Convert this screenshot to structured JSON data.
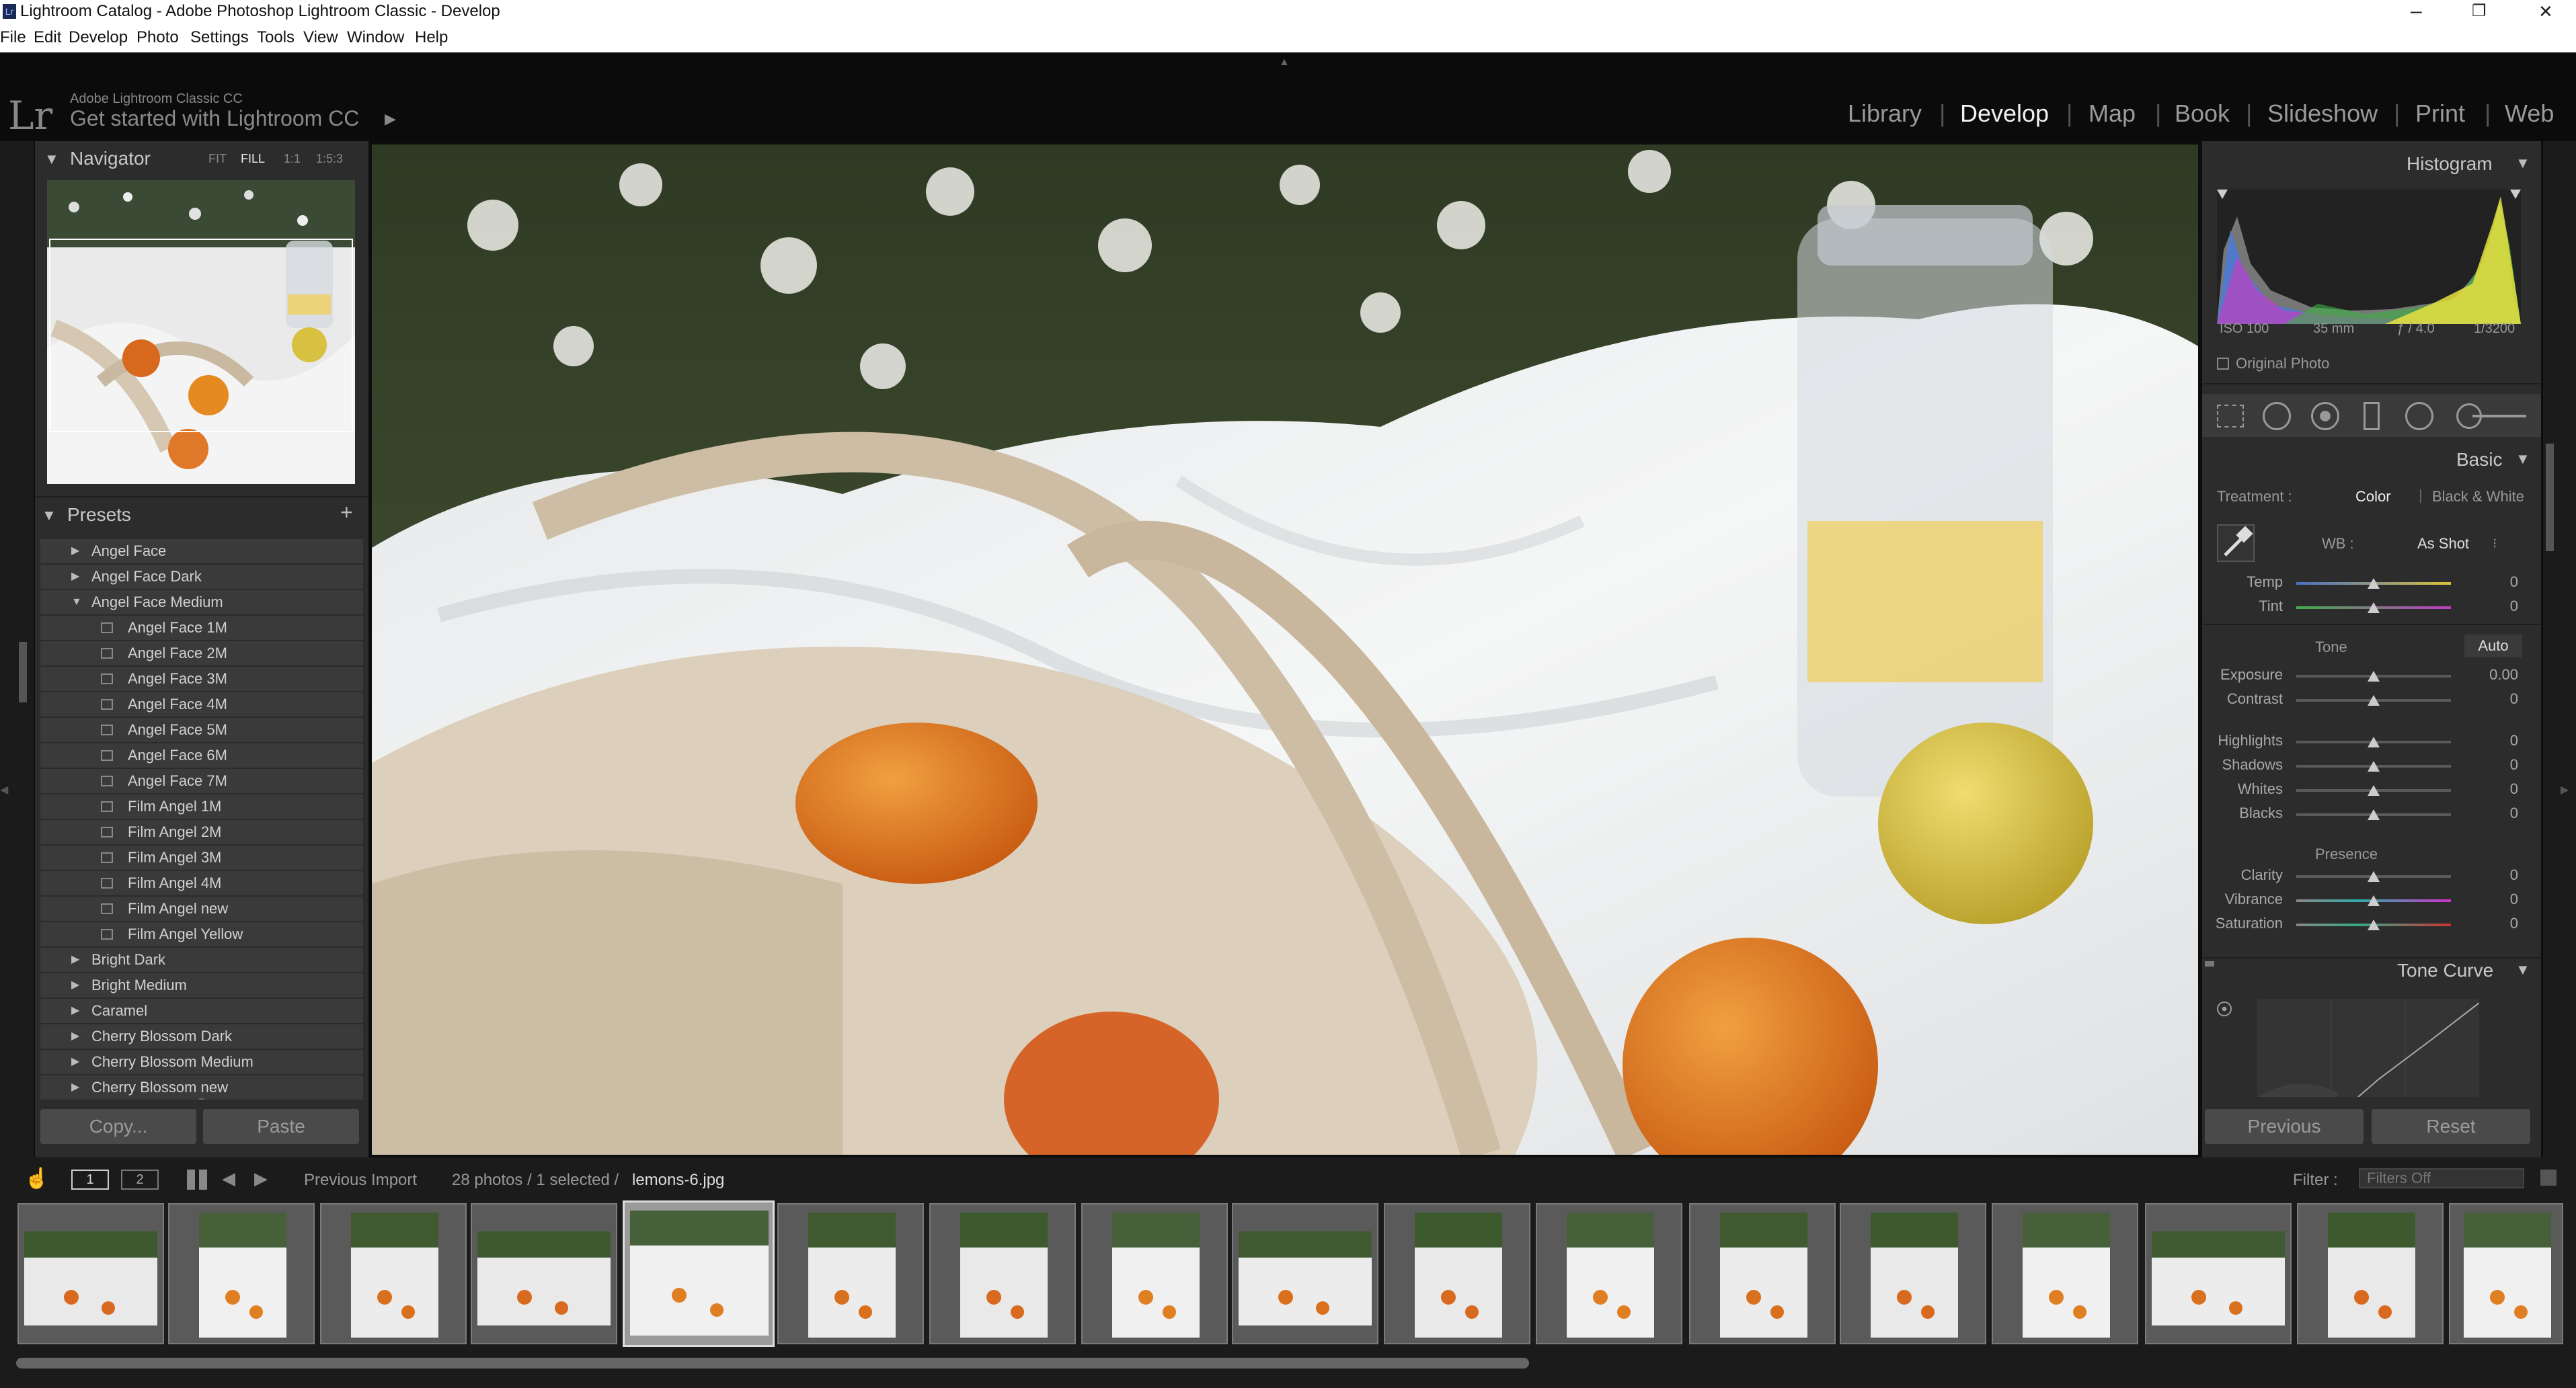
{
  "window": {
    "title": "Lightroom Catalog - Adobe Photoshop Lightroom Classic - Develop",
    "menu": [
      "File",
      "Edit",
      "Develop",
      "Photo",
      "Settings",
      "Tools",
      "View",
      "Window",
      "Help"
    ],
    "controls": [
      "–",
      "❐",
      "✕"
    ]
  },
  "identity": {
    "logo": "Lr",
    "small": "Adobe Lightroom Classic CC",
    "main": "Get started with Lightroom CC"
  },
  "modules": [
    "Library",
    "Develop",
    "Map",
    "Book",
    "Slideshow",
    "Print",
    "Web"
  ],
  "active_module": "Develop",
  "navigator": {
    "title": "Navigator",
    "zoom": [
      "FIT",
      "FILL",
      "1:1",
      "1:5:3"
    ]
  },
  "presets": {
    "title": "Presets",
    "add": "+",
    "items": [
      {
        "label": "Angel Face",
        "sub": false
      },
      {
        "label": "Angel Face Dark",
        "sub": false
      },
      {
        "label": "Angel Face Medium",
        "sub": false,
        "open": true
      },
      {
        "label": "Angel Face 1M",
        "sub": true
      },
      {
        "label": "Angel Face 2M",
        "sub": true
      },
      {
        "label": "Angel Face 3M",
        "sub": true
      },
      {
        "label": "Angel Face 4M",
        "sub": true
      },
      {
        "label": "Angel Face 5M",
        "sub": true
      },
      {
        "label": "Angel Face 6M",
        "sub": true
      },
      {
        "label": "Angel Face 7M",
        "sub": true
      },
      {
        "label": "Film Angel 1M",
        "sub": true
      },
      {
        "label": "Film Angel 2M",
        "sub": true
      },
      {
        "label": "Film Angel 3M",
        "sub": true
      },
      {
        "label": "Film Angel 4M",
        "sub": true
      },
      {
        "label": "Film Angel new",
        "sub": true
      },
      {
        "label": "Film Angel Yellow",
        "sub": true
      },
      {
        "label": "Bright Dark",
        "sub": false
      },
      {
        "label": "Bright Medium",
        "sub": false
      },
      {
        "label": "Caramel",
        "sub": false
      },
      {
        "label": "Cherry Blossom Dark",
        "sub": false
      },
      {
        "label": "Cherry Blossom Medium",
        "sub": false
      },
      {
        "label": "Cherry Blossom new",
        "sub": false
      }
    ]
  },
  "left_buttons": {
    "copy": "Copy...",
    "paste": "Paste"
  },
  "histogram": {
    "title": "Histogram",
    "iso": "ISO 100",
    "focal": "35 mm",
    "aperture": "ƒ / 4.0",
    "shutter": "1/3200",
    "original": "Original Photo"
  },
  "basic": {
    "title": "Basic",
    "treatment_label": "Treatment :",
    "color": "Color",
    "bw": "Black & White",
    "wb_label": "WB :",
    "wb_value": "As Shot",
    "tone_label": "Tone",
    "auto": "Auto",
    "presence_label": "Presence",
    "sliders": [
      {
        "label": "Temp",
        "value": "0",
        "pos": 0.5
      },
      {
        "label": "Tint",
        "value": "0",
        "pos": 0.5
      },
      {
        "label": "Exposure",
        "value": "0.00",
        "pos": 0.5
      },
      {
        "label": "Contrast",
        "value": "0",
        "pos": 0.5
      },
      {
        "label": "Highlights",
        "value": "0",
        "pos": 0.5
      },
      {
        "label": "Shadows",
        "value": "0",
        "pos": 0.5
      },
      {
        "label": "Whites",
        "value": "0",
        "pos": 0.5
      },
      {
        "label": "Blacks",
        "value": "0",
        "pos": 0.5
      },
      {
        "label": "Clarity",
        "value": "0",
        "pos": 0.5
      },
      {
        "label": "Vibrance",
        "value": "0",
        "pos": 0.5
      },
      {
        "label": "Saturation",
        "value": "0",
        "pos": 0.5
      }
    ]
  },
  "tone_curve": {
    "title": "Tone Curve"
  },
  "right_buttons": {
    "previous": "Previous",
    "reset": "Reset"
  },
  "filmstrip": {
    "screen1": "1",
    "screen2": "2",
    "source": "Previous Import",
    "count": "28 photos / 1 selected /",
    "filename": "lemons-6.jpg",
    "filter_label": "Filter :",
    "filter_value": "Filters Off"
  },
  "colors": {
    "accent": "#ffffff",
    "panel": "#2c2c2c",
    "background": "#0d0d0d"
  }
}
